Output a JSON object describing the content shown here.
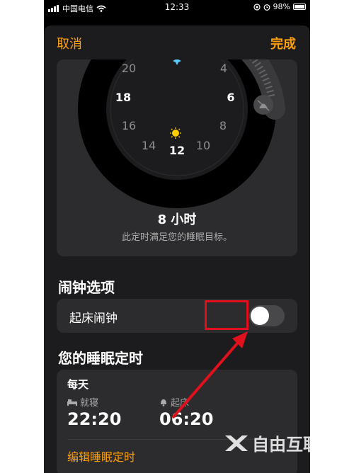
{
  "status_bar": {
    "carrier": "中国电信",
    "time": "12:33",
    "battery": "98%"
  },
  "header": {
    "cancel_label": "取消",
    "done_label": "完成"
  },
  "clock": {
    "hour_labels": [
      "20",
      "4",
      "18",
      "6",
      "16",
      "8",
      "14",
      "12",
      "10"
    ],
    "duration": "8 小时",
    "duration_note": "此定时满足您的睡眠目标。"
  },
  "alarm_section": {
    "title": "闹钟选项",
    "wake_alarm_label": "起床闹钟",
    "wake_alarm_on": false
  },
  "schedule_section": {
    "title": "您的睡眠定时",
    "repeat": "每天",
    "bedtime_label": "就寝",
    "bedtime": "22:20",
    "wake_label": "起床",
    "wake_time": "06:20",
    "edit_label": "编辑睡眠定时"
  },
  "watermark": {
    "text": "自由互联"
  },
  "colors": {
    "accent": "#ff9f0a",
    "highlight": "#e0101c"
  }
}
